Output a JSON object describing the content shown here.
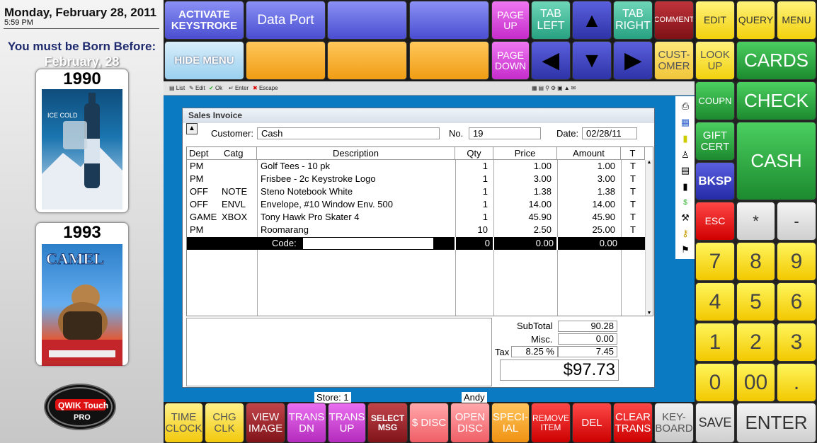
{
  "left": {
    "date": "Monday, February 28, 2011",
    "time": "5:59 PM",
    "born_label": "You must be Born Before:",
    "born_date": "February, 28",
    "cards": [
      {
        "year": "1990"
      },
      {
        "year": "1993"
      }
    ],
    "logo_text": "QWIK Touch",
    "logo_sub": "PRO"
  },
  "top": {
    "activate": "ACTIVATE KEYSTROKE",
    "dataport": "Data Port",
    "hidemenu": "HIDE MENU",
    "pageup": "PAGE UP",
    "pagedown": "PAGE DOWN",
    "tableft": "TAB LEFT",
    "tabright": "TAB RIGHT",
    "comment": "COMMENT",
    "customer": "CUST-OMER",
    "lookup": "LOOK UP",
    "edit": "EDIT",
    "query": "QUERY",
    "menu": "MENU",
    "up": "▲",
    "left": "◀",
    "down": "▼",
    "right": "▶"
  },
  "toolbar": {
    "list": "List",
    "edit": "Edit",
    "ok": "Ok",
    "enter": "Enter",
    "escape": "Escape"
  },
  "invoice": {
    "title": "Sales Invoice",
    "customer_label": "Customer:",
    "customer": "Cash",
    "no_label": "No.",
    "no": "19",
    "date_label": "Date:",
    "date": "02/28/11",
    "columns": {
      "dept": "Dept",
      "catg": "Catg",
      "desc": "Description",
      "qty": "Qty",
      "price": "Price",
      "amount": "Amount",
      "t": "T"
    },
    "rows": [
      {
        "dept": "PM",
        "catg": "",
        "desc": "Golf Tees - 10 pk",
        "qty": "1",
        "price": "1.00",
        "amount": "1.00",
        "t": "T"
      },
      {
        "dept": "PM",
        "catg": "",
        "desc": "Frisbee - 2c Keystroke Logo",
        "qty": "1",
        "price": "3.00",
        "amount": "3.00",
        "t": "T"
      },
      {
        "dept": "OFF",
        "catg": "NOTE",
        "desc": "Steno Notebook White",
        "qty": "1",
        "price": "1.38",
        "amount": "1.38",
        "t": "T"
      },
      {
        "dept": "OFF",
        "catg": "ENVL",
        "desc": "Envelope, #10 Window Env. 500",
        "qty": "1",
        "price": "14.00",
        "amount": "14.00",
        "t": "T"
      },
      {
        "dept": "GAME",
        "catg": "XBOX",
        "desc": "Tony Hawk Pro Skater 4",
        "qty": "1",
        "price": "45.90",
        "amount": "45.90",
        "t": "T"
      },
      {
        "dept": "PM",
        "catg": "",
        "desc": "Roomarang",
        "qty": "10",
        "price": "2.50",
        "amount": "25.00",
        "t": "T"
      }
    ],
    "entry": {
      "code_label": "Code:",
      "qty": "0",
      "price": "0.00",
      "amount": "0.00"
    },
    "subtotal_label": "SubTotal",
    "subtotal": "90.28",
    "misc_label": "Misc.",
    "misc": "0.00",
    "tax_label": "Tax",
    "tax_rate": "8.25 %",
    "tax": "7.45",
    "total": "$97.73"
  },
  "status": {
    "store": "Store: 1",
    "user": "Andy"
  },
  "right": {
    "cards": "CARDS",
    "coupn": "COUPN",
    "check": "CHECK",
    "gift": "GIFT CERT",
    "cash": "CASH",
    "bksp": "BKSP",
    "esc": "ESC",
    "star": "*",
    "minus": "-",
    "keys": [
      "7",
      "8",
      "9",
      "4",
      "5",
      "6",
      "1",
      "2",
      "3",
      "0",
      "00",
      "."
    ],
    "save": "SAVE",
    "enter": "ENTER"
  },
  "bottom": {
    "timeclock": "TIME CLOCK",
    "chgclk": "CHG CLK",
    "viewimage": "VIEW IMAGE",
    "transdn": "TRANS DN",
    "transup": "TRANS UP",
    "selectmsg": "SELECT MSG",
    "sdisc": "$ DISC",
    "opendisc": "OPEN DISC",
    "special": "SPECI-IAL",
    "removeitem": "REMOVE ITEM",
    "del": "DEL",
    "cleartrans": "CLEAR TRANS",
    "keyboard": "KEY-BOARD"
  }
}
